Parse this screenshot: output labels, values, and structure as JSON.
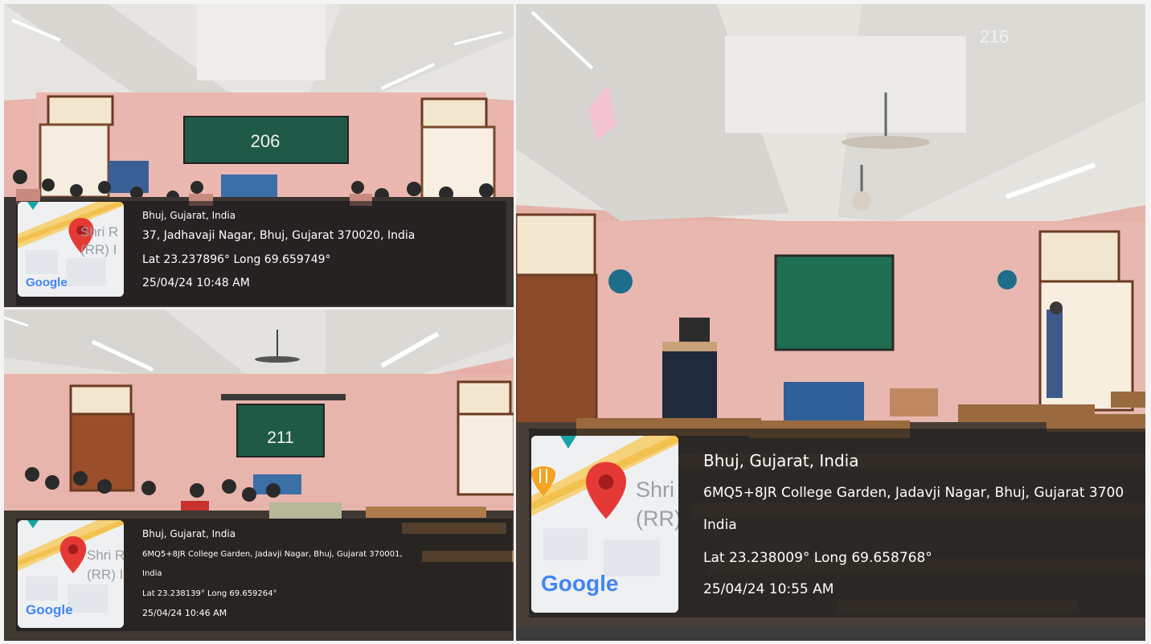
{
  "photos": [
    {
      "room_label": "206",
      "map": {
        "place_label": "Shri R",
        "place_label_2": "(RR) I",
        "logo": "Google"
      },
      "location": {
        "city": "Bhuj, Gujarat, India",
        "address_line1": "37, Jadhavaji Nagar, Bhuj, Gujarat 370020, India",
        "address_line2": "",
        "coords": "Lat 23.237896° Long 69.659749°",
        "timestamp": "25/04/24 10:48 AM"
      }
    },
    {
      "room_label": "211",
      "map": {
        "place_label": "Shri R",
        "place_label_2": "(RR) I",
        "logo": "Google"
      },
      "location": {
        "city": "Bhuj, Gujarat, India",
        "address_line1": "6MQ5+8JR College Garden, Jadavji Nagar, Bhuj, Gujarat 370001,",
        "address_line2": "India",
        "coords": "Lat 23.238139° Long 69.659264°",
        "timestamp": "25/04/24 10:46 AM"
      }
    },
    {
      "room_label": "216",
      "map": {
        "place_label": "Shri",
        "place_label_2": "(RR)",
        "logo": "Google"
      },
      "location": {
        "city": "Bhuj, Gujarat, India",
        "address_line1": "6MQ5+8JR College Garden, Jadavji Nagar, Bhuj, Gujarat 3700",
        "address_line2": "India",
        "coords": "Lat 23.238009° Long 69.658768°",
        "timestamp": "25/04/24 10:55 AM"
      }
    }
  ],
  "colors": {
    "wall": "#e8b9b2",
    "ceiling": "#e9e7e2",
    "board": "#1f5a46",
    "pin": "#e53935",
    "map_road": "#f2c14e"
  },
  "icons": [
    "map-pin-icon",
    "fork-knife-icon"
  ]
}
